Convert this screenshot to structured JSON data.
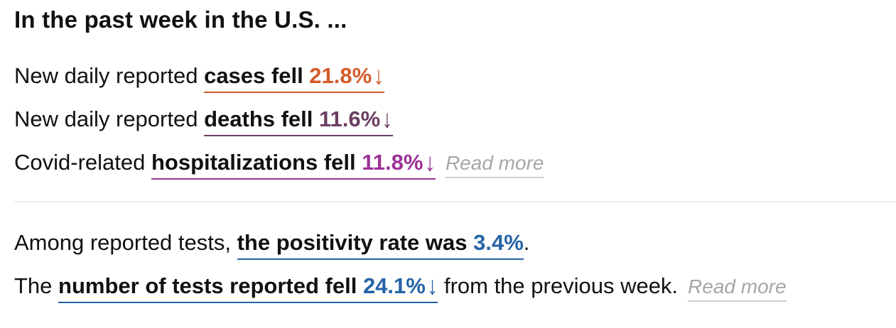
{
  "title": "In the past week in the U.S. ...",
  "colors": {
    "cases": "#d45b2a",
    "deaths": "#6b3e63",
    "hospitalizations": "#9b3296",
    "tests": "#2563a6",
    "read_more": "#a6a6a6"
  },
  "rows": {
    "cases": {
      "prefix": "New daily reported ",
      "metric_text": "cases fell ",
      "value": "21.8%",
      "arrow": "↓"
    },
    "deaths": {
      "prefix": "New daily reported ",
      "metric_text": "deaths fell ",
      "value": "11.6%",
      "arrow": "↓"
    },
    "hospitalizations": {
      "prefix": "Covid-related ",
      "metric_text": "hospitalizations fell ",
      "value": "11.8%",
      "arrow": "↓",
      "read_more": "Read more"
    },
    "positivity": {
      "prefix": "Among reported tests, ",
      "metric_text": "the positivity rate was ",
      "value": "3.4%",
      "suffix": "."
    },
    "tests": {
      "prefix": "The ",
      "metric_text": "number of tests reported fell ",
      "value": "24.1%",
      "arrow": "↓",
      "suffix": " from the previous week.",
      "read_more": "Read more"
    }
  }
}
